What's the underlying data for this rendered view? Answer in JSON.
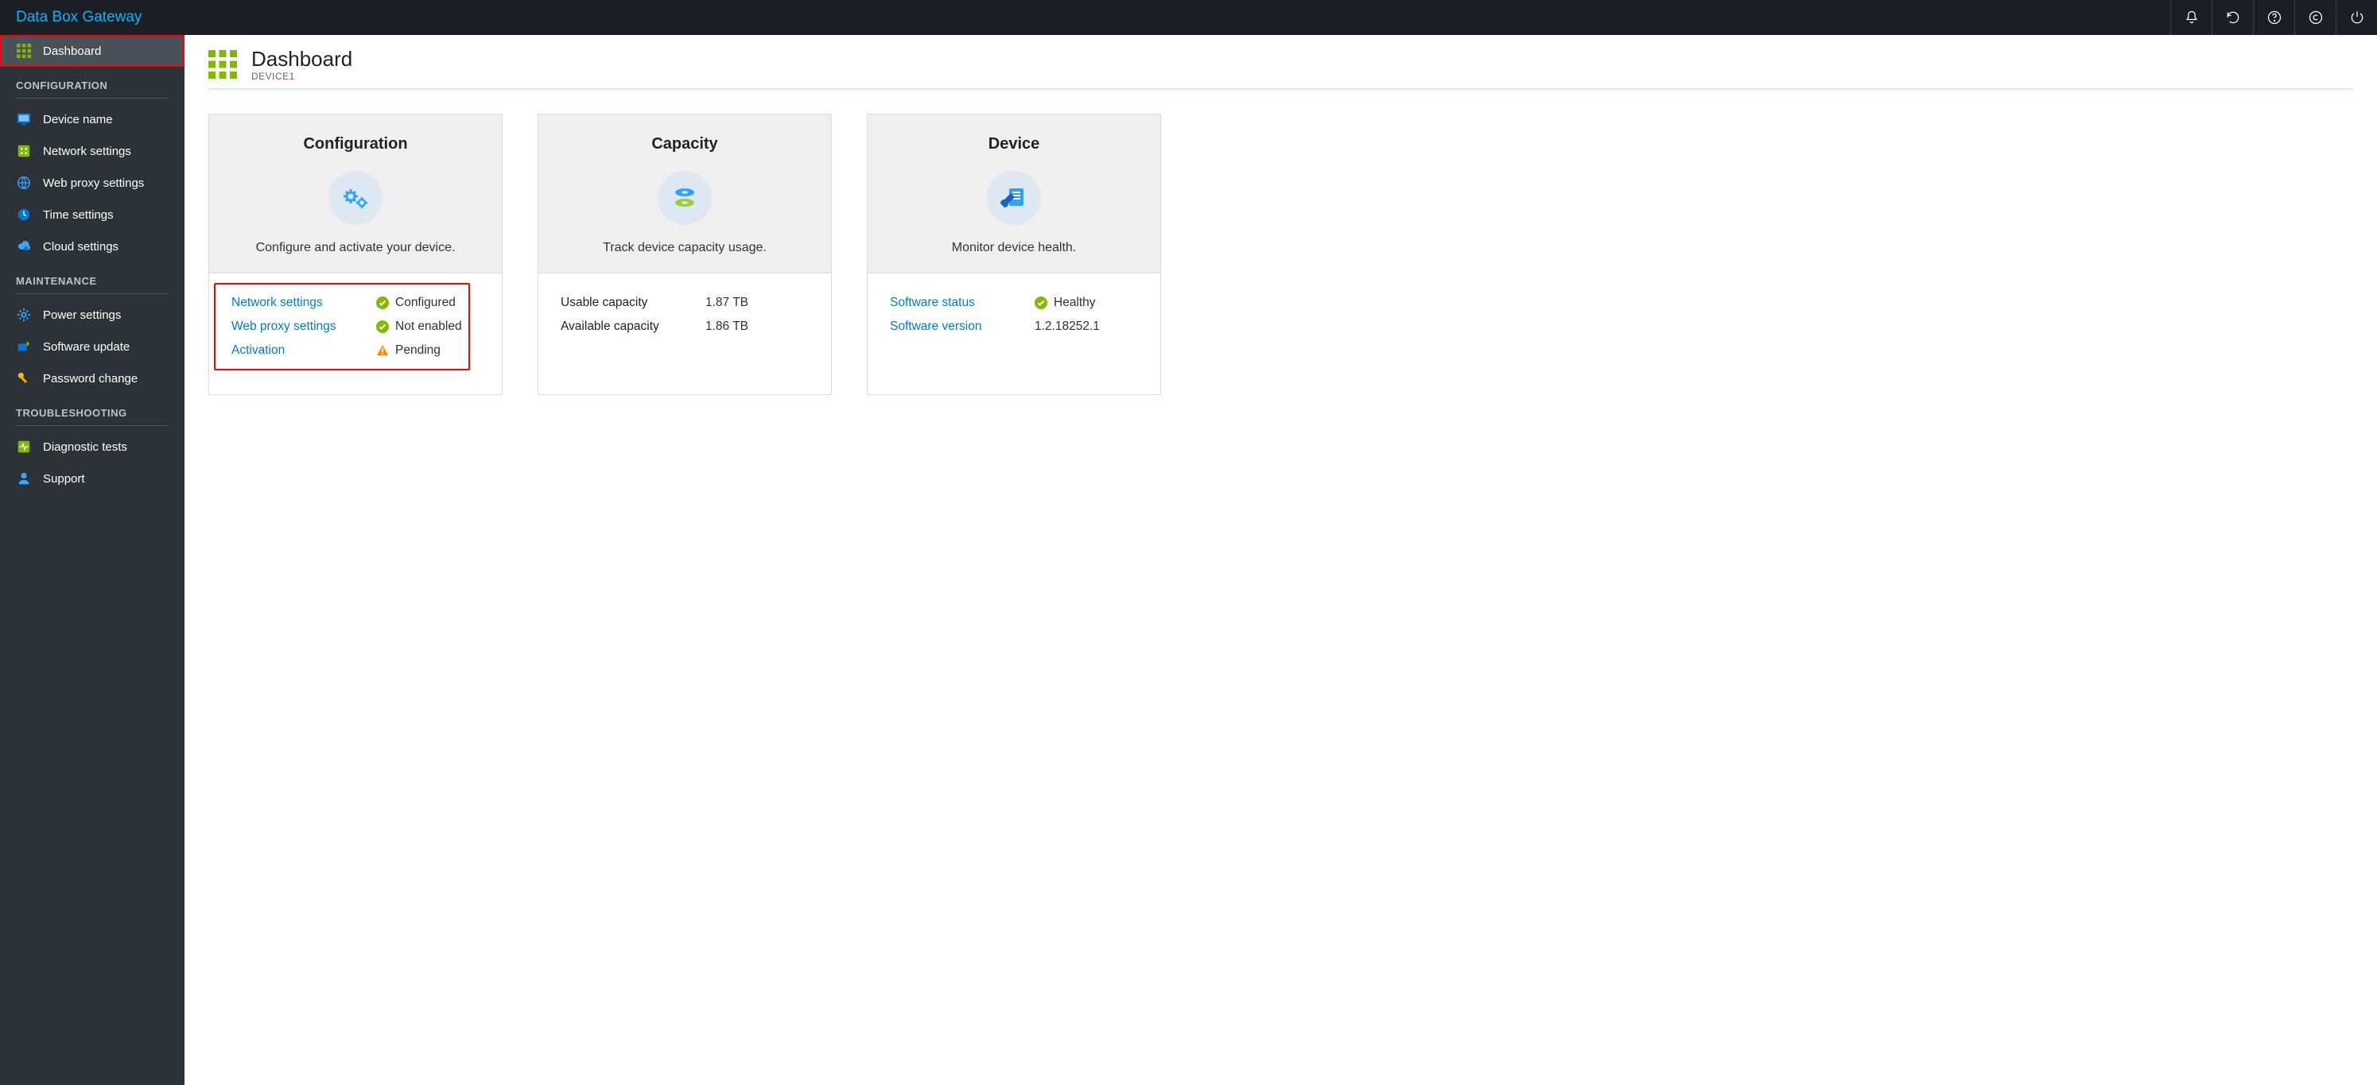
{
  "app": {
    "title": "Data Box Gateway"
  },
  "sidebar": {
    "dashboard": "Dashboard",
    "sections": {
      "configuration": "CONFIGURATION",
      "maintenance": "MAINTENANCE",
      "troubleshooting": "TROUBLESHOOTING"
    },
    "items": {
      "device_name": "Device name",
      "network_settings": "Network settings",
      "web_proxy_settings": "Web proxy settings",
      "time_settings": "Time settings",
      "cloud_settings": "Cloud settings",
      "power_settings": "Power settings",
      "software_update": "Software update",
      "password_change": "Password change",
      "diagnostic_tests": "Diagnostic tests",
      "support": "Support"
    }
  },
  "page": {
    "title": "Dashboard",
    "device": "DEVICE1"
  },
  "cards": {
    "configuration": {
      "title": "Configuration",
      "desc": "Configure and activate your device.",
      "rows": {
        "network": {
          "label": "Network settings",
          "status": "Configured",
          "state": "ok"
        },
        "webproxy": {
          "label": "Web proxy settings",
          "status": "Not enabled",
          "state": "ok"
        },
        "activation": {
          "label": "Activation",
          "status": "Pending",
          "state": "warn"
        }
      }
    },
    "capacity": {
      "title": "Capacity",
      "desc": "Track device capacity usage.",
      "rows": {
        "usable": {
          "label": "Usable capacity",
          "value": "1.87 TB"
        },
        "available": {
          "label": "Available capacity",
          "value": "1.86 TB"
        }
      }
    },
    "device": {
      "title": "Device",
      "desc": "Monitor device health.",
      "rows": {
        "software_status": {
          "label": "Software status",
          "value": "Healthy",
          "state": "ok"
        },
        "software_version": {
          "label": "Software version",
          "value": "1.2.18252.1"
        }
      }
    }
  }
}
